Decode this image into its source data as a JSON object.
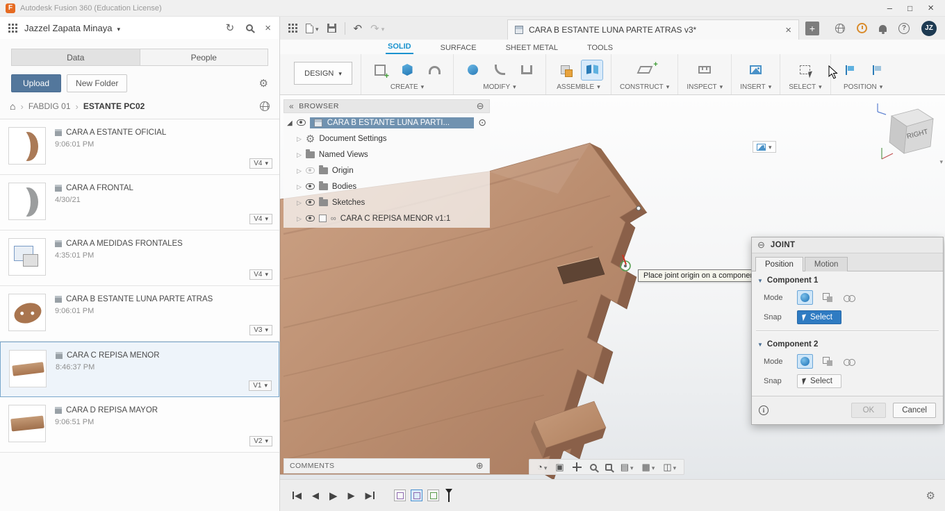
{
  "titlebar": {
    "title": "Autodesk Fusion 360 (Education License)"
  },
  "data_panel": {
    "user_name": "Jazzel Zapata Minaya",
    "tabs": [
      {
        "label": "Data",
        "active": true
      },
      {
        "label": "People",
        "active": false
      }
    ],
    "upload_button": "Upload",
    "new_folder_button": "New Folder",
    "breadcrumb": {
      "root": "FABDIG 01",
      "current": "ESTANTE PC02"
    },
    "files": [
      {
        "name": "CARA A ESTANTE OFICIAL",
        "modified": "9:06:01 PM",
        "version": "V4",
        "selected": false
      },
      {
        "name": "CARA A FRONTAL",
        "modified": "4/30/21",
        "version": "V4",
        "selected": false
      },
      {
        "name": "CARA A MEDIDAS FRONTALES",
        "modified": "4:35:01 PM",
        "version": "V4",
        "selected": false
      },
      {
        "name": "CARA B ESTANTE LUNA PARTE ATRAS",
        "modified": "9:06:01 PM",
        "version": "V3",
        "selected": false
      },
      {
        "name": "CARA C REPISA MENOR",
        "modified": "8:46:37 PM",
        "version": "V1",
        "selected": true
      },
      {
        "name": "CARA D REPISA MAYOR",
        "modified": "9:06:51 PM",
        "version": "V2",
        "selected": false
      }
    ]
  },
  "app_toolbar": {
    "document_tab": "CARA B ESTANTE LUNA PARTE ATRAS v3*",
    "avatar_initials": "JZ"
  },
  "ribbon": {
    "design_menu": "DESIGN",
    "tabs": [
      {
        "label": "SOLID",
        "active": true
      },
      {
        "label": "SURFACE",
        "active": false
      },
      {
        "label": "SHEET METAL",
        "active": false
      },
      {
        "label": "TOOLS",
        "active": false
      }
    ],
    "groups": [
      {
        "label": "CREATE"
      },
      {
        "label": "MODIFY"
      },
      {
        "label": "ASSEMBLE"
      },
      {
        "label": "CONSTRUCT"
      },
      {
        "label": "INSPECT"
      },
      {
        "label": "INSERT"
      },
      {
        "label": "SELECT"
      },
      {
        "label": "POSITION"
      }
    ]
  },
  "browser": {
    "title": "BROWSER",
    "root_item": "CARA  B ESTANTE LUNA PARTI...",
    "items": [
      "Document Settings",
      "Named Views",
      "Origin",
      "Bodies",
      "Sketches",
      "CARA C REPISA  MENOR v1:1"
    ]
  },
  "viewport": {
    "tooltip": "Place joint origin on a component",
    "viewcube_face": "RIGHT"
  },
  "joint_dialog": {
    "title": "JOINT",
    "tabs": [
      {
        "label": "Position",
        "active": true
      },
      {
        "label": "Motion",
        "active": false
      }
    ],
    "component1": {
      "title": "Component 1",
      "mode_label": "Mode",
      "snap_label": "Snap",
      "select_button": "Select"
    },
    "component2": {
      "title": "Component 2",
      "mode_label": "Mode",
      "snap_label": "Snap",
      "select_button": "Select"
    },
    "ok_button": "OK",
    "cancel_button": "Cancel"
  },
  "comments_bar": {
    "label": "COMMENTS"
  },
  "colors": {
    "accent_blue": "#1a93cf",
    "selection_blue": "#2f7bc2",
    "upload_blue": "#53779c",
    "wood_light": "#c9a183",
    "wood_dark": "#8a6049"
  }
}
